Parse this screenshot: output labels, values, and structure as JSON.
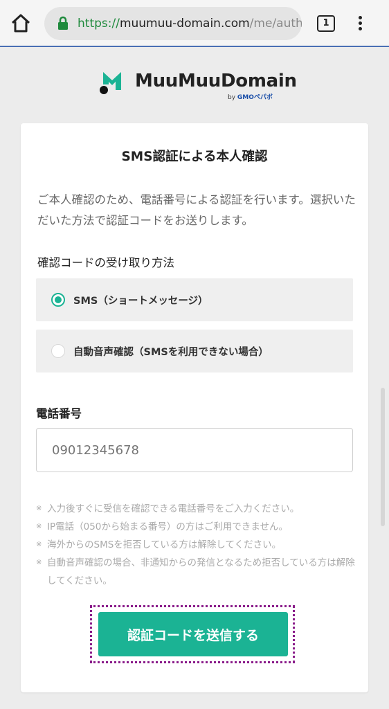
{
  "browser": {
    "url_scheme": "https://",
    "url_host": "muumuu-domain.com",
    "url_path": "/me/auth",
    "tab_count": "1"
  },
  "logo": {
    "name": "MuuMuuDomain",
    "by": "by",
    "brand": "GMOペパボ"
  },
  "page": {
    "title": "SMS認証による本人確認",
    "intro": "ご本人確認のため、電話番号による認証を行います。選択いただいた方法で認証コードをお送りします。",
    "method_label": "確認コードの受け取り方法",
    "options": [
      {
        "label": "SMS（ショートメッセージ）",
        "selected": true
      },
      {
        "label": "自動音声確認（SMSを利用できない場合）",
        "selected": false
      }
    ],
    "phone_label": "電話番号",
    "phone_placeholder": "09012345678",
    "notes": [
      "入力後すぐに受信を確認できる電話番号をご入力ください。",
      "IP電話（050から始まる番号）の方はご利用できません。",
      "海外からのSMSを拒否している方は解除してください。",
      "自動音声確認の場合、非通知からの発信となるため拒否している方は解除してください。"
    ],
    "submit_label": "認証コードを送信する"
  },
  "colors": {
    "accent": "#1bb394",
    "url_scheme": "#1f8a3d",
    "highlight_border": "#8a1c8a"
  },
  "icons": [
    "home-icon",
    "lock-icon",
    "tab-switcher-icon",
    "more-vert-icon",
    "muumuu-logo-icon"
  ]
}
